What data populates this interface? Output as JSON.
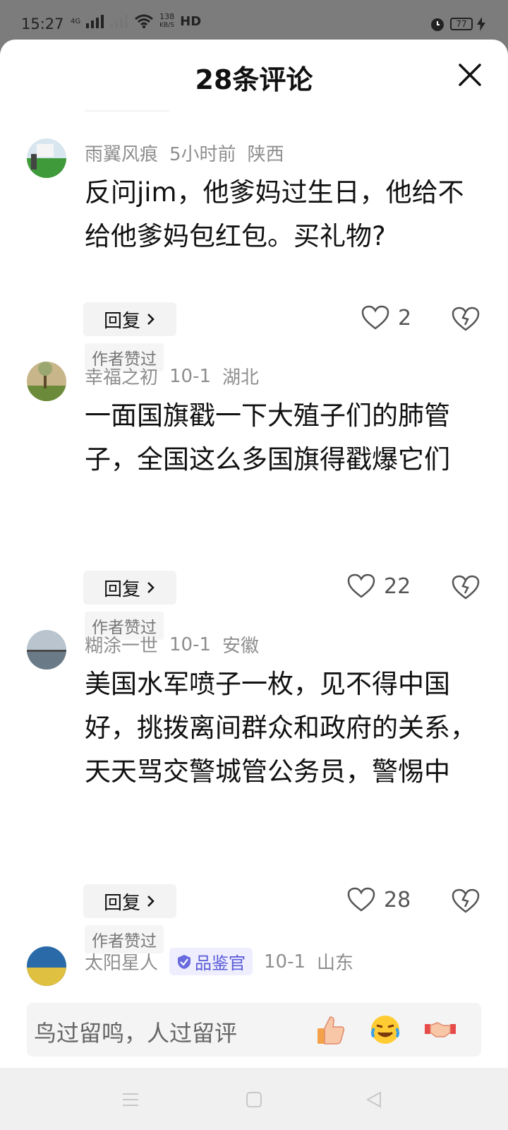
{
  "status_bar": {
    "time": "15:27",
    "network_label": "4G",
    "speed_value": "138",
    "speed_unit": "KB/S",
    "hd_label": "HD",
    "battery_level": "77"
  },
  "sheet": {
    "title": "28条评论",
    "close_icon": "close-icon"
  },
  "comments": [
    {
      "username": "雨翼风痕",
      "time": "5小时前",
      "location": "陕西",
      "text": "反问jim，他爹妈过生日，他给不给他爹妈包红包。买礼物?",
      "reply_label": "回复",
      "likes": "2",
      "author_liked": "作者赞过"
    },
    {
      "username": "幸福之初",
      "time": "10-1",
      "location": "湖北",
      "text": "一面国旗戳一下大殖子们的肺管子，全国这么多国旗得戳爆它们",
      "reply_label": "回复",
      "likes": "22",
      "author_liked": "作者赞过"
    },
    {
      "username": "糊涂一世",
      "time": "10-1",
      "location": "安徽",
      "text": "美国水军喷子一枚，见不得中国好，挑拨离间群众和政府的关系，天天骂交警城管公务员，警惕中",
      "reply_label": "回复",
      "likes": "28",
      "author_liked": "作者赞过"
    },
    {
      "username": "太阳星人",
      "badge": "品鉴官",
      "time": "10-1",
      "location": "山东"
    }
  ],
  "input_bar": {
    "placeholder": "鸟过留鸣，人过留评",
    "emojis": [
      "thumbs-up-emoji",
      "crying-laughing-emoji",
      "handshake-emoji"
    ]
  },
  "nav_bar": {
    "items": [
      "menu-icon",
      "home-square-icon",
      "back-triangle-icon"
    ]
  },
  "colors": {
    "text_primary": "#111111",
    "text_meta": "#8e8e8e",
    "badge_bg": "#eeeefe",
    "badge_text": "#5b5bd8"
  }
}
